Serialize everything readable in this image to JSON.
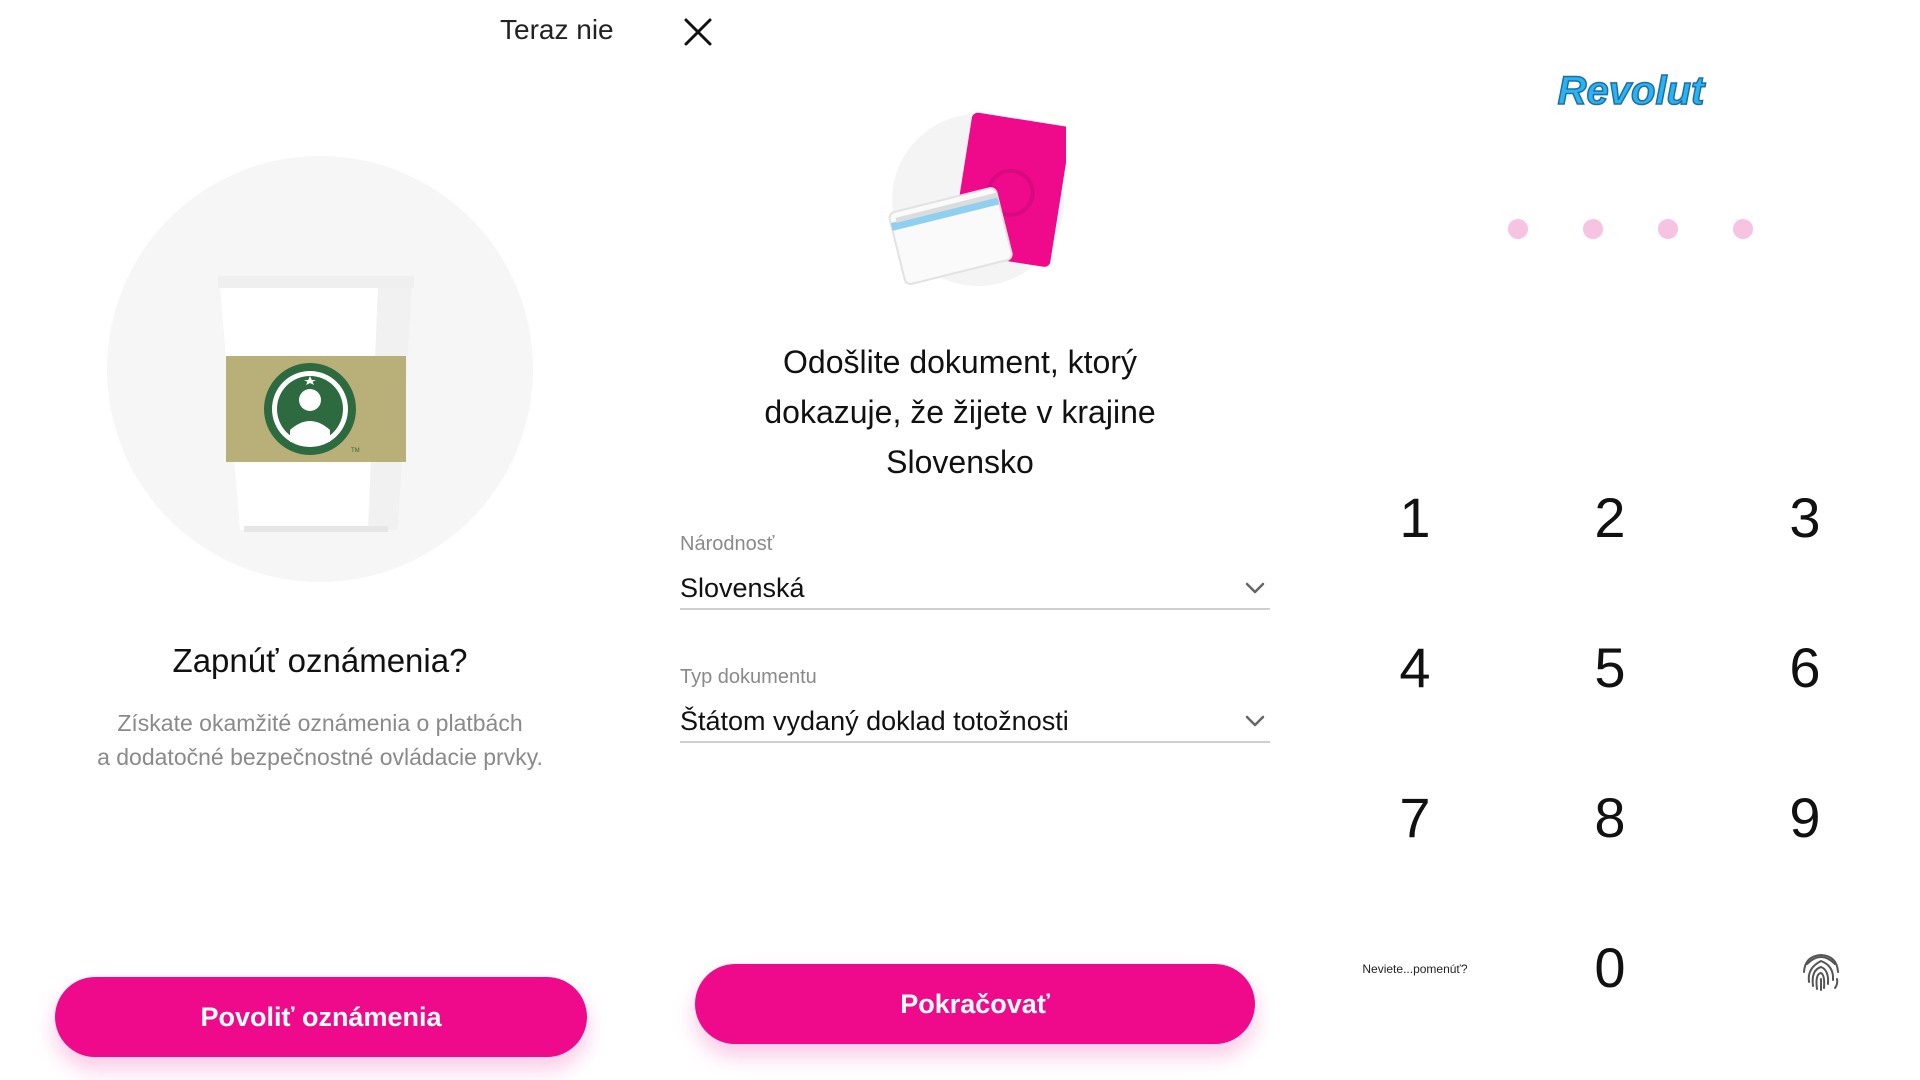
{
  "panel1": {
    "skip_label": "Teraz nie",
    "title": "Zapnúť oznámenia?",
    "subtitle_line1": "Získate okamžité oznámenia o platbách",
    "subtitle_line2": "a dodatočné bezpečnostné ovládacie prvky.",
    "button_label": "Povoliť oznámenia"
  },
  "panel2": {
    "title_line1": "Odošlite dokument, ktorý",
    "title_line2": "dokazuje, že žijete v krajine",
    "title_line3": "Slovensko",
    "nationality_label": "Národnosť",
    "nationality_value": "Slovenská",
    "document_type_label": "Typ dokumentu",
    "document_type_value": "Štátom vydaný doklad totožnosti",
    "button_label": "Pokračovať"
  },
  "panel3": {
    "logo_text": "Revolut",
    "pin_length": 4,
    "keys": [
      "1",
      "2",
      "3",
      "4",
      "5",
      "6",
      "7",
      "8",
      "9",
      "0"
    ],
    "forgot_label": "Neviete...pomenúť?"
  },
  "icons": {
    "close": "close-icon",
    "chevron": "chevron-down-icon",
    "fingerprint": "fingerprint-icon"
  },
  "colors": {
    "accent": "#ee0a8b",
    "pin_dot": "#f6c3e3",
    "logo_blue": "#2bb3f0"
  }
}
